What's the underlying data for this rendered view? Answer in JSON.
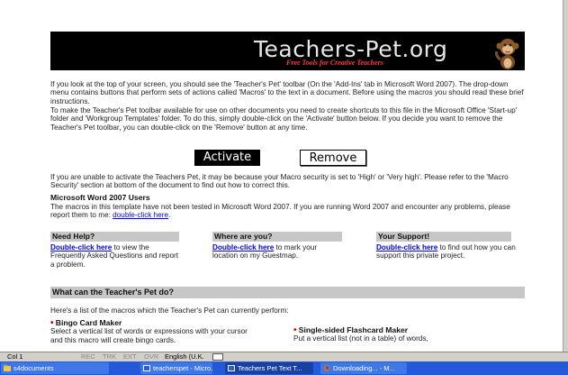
{
  "banner": {
    "title": "Teachers-Pet.org",
    "subtitle": "Free Tools for Creative Teachers",
    "logo_icon": "monkey-icon"
  },
  "intro": {
    "p1": "If you look at the top of your screen, you should see the 'Teacher's Pet' toolbar (On the 'Add-Ins' tab in Microsoft Word 2007). The drop-down menu contains buttons that perform sets of actions called 'Macros' to the text in a document. Before using the macros you should read these brief instructions.",
    "p2": "To make the Teacher's Pet toolbar available for use on other documents you need to create shortcuts to this file in the Microsoft Office 'Start-up' folder and 'Workgroup Templates' folder. To do this, simply double-click on the 'Activate' button below. If you decide you want to remove the Teacher's Pet toolbar, you can double-click on the 'Remove' button at any time."
  },
  "buttons": {
    "activate": "Activate",
    "remove": "Remove"
  },
  "security": "If you are unable to activate the Teachers Pet, it may be because your Macro security is set to 'High' or 'Very high'. Please refer to the 'Macro Security' section at bottom of the document to find out how to correct this.",
  "word2007": {
    "heading": "Microsoft Word 2007 Users",
    "text": "The macros in this template have not been tested in Microsoft Word 2007. If you are running Word 2007 and encounter any problems, please report them to me: ",
    "link": "double-click here",
    "after": "."
  },
  "columns": [
    {
      "heading": "Need Help?",
      "link": "Double-click here",
      "text": " to view the Frequently Asked Questions and report a problem."
    },
    {
      "heading": "Where are you?",
      "link": "Double-click here",
      "text": " to mark your location on my Guestmap."
    },
    {
      "heading": "Your Support!",
      "link": "Double-click here",
      "text": " to find out how you can support this private project."
    }
  ],
  "section": {
    "heading": "What can the Teacher's Pet do?",
    "intro": "Here's a list of the macros which the Teacher's Pet can currently perform:",
    "items": [
      {
        "title": "Bingo Card Maker",
        "text": "Select a vertical list of words or expressions with your cursor and this macro will create bingo cards."
      },
      {
        "title": "Single-sided Flashcard Maker",
        "text": "Put a vertical list (not in a table) of words,"
      }
    ]
  },
  "statusbar": {
    "col": "Col 1",
    "rec": "REC",
    "trk": "TRK",
    "ext": "EXT",
    "ovr": "OVR",
    "language": "English (U.K."
  },
  "taskbar": [
    {
      "label": "s4documents",
      "icon": "folder-icon"
    },
    {
      "label": "teacherspet - Micro...",
      "icon": "word-icon"
    },
    {
      "label": "Teachers Pet Text T...",
      "icon": "word-icon"
    },
    {
      "label": "Downloading... - M...",
      "icon": "firefox-icon"
    }
  ],
  "colors": {
    "banner_bg": "#000000",
    "banner_subtitle": "#ff3b3b",
    "section_bg": "#c7c7c7",
    "link": "#0000ee",
    "bullet": "#e00000",
    "taskbar": "#2459d9"
  }
}
